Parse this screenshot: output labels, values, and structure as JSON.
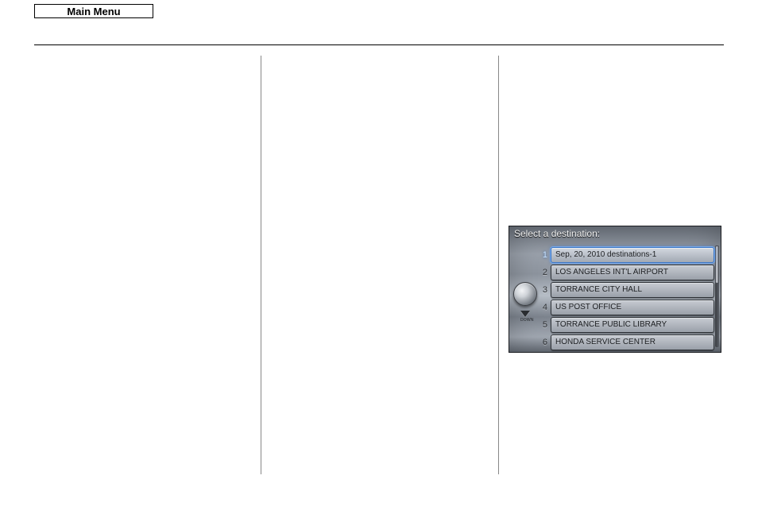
{
  "header": {
    "main_menu_label": "Main Menu"
  },
  "nav_screen": {
    "title": "Select a destination:",
    "down_label": "DOWN",
    "rows": [
      {
        "num": "1",
        "label": "Sep, 20, 2010 destinations-1",
        "selected": true
      },
      {
        "num": "2",
        "label": "LOS ANGELES INT'L AIRPORT",
        "selected": false
      },
      {
        "num": "3",
        "label": "TORRANCE CITY HALL",
        "selected": false
      },
      {
        "num": "4",
        "label": "US POST OFFICE",
        "selected": false
      },
      {
        "num": "5",
        "label": "TORRANCE PUBLIC LIBRARY",
        "selected": false
      },
      {
        "num": "6",
        "label": "HONDA SERVICE CENTER",
        "selected": false
      }
    ]
  }
}
